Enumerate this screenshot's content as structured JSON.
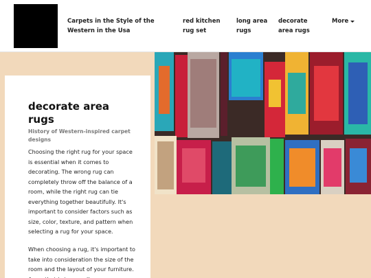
{
  "header": {
    "nav": [
      "Carpets in the Style of the Western in the Usa",
      "red kitchen rug set",
      "long area rugs",
      "decorate area rugs"
    ],
    "more_label": "More"
  },
  "article": {
    "title": "decorate area rugs",
    "subtitle": "History of Western-inspired carpet designs",
    "paragraphs": [
      "Choosing the right rug for your space is essential when it comes to decorating. The wrong rug can completely throw off the balance of a room, while the right rug can tie everything together beautifully. It's important to consider factors such as size, color, texture, and pattern when selecting a rug for your space.",
      "When choosing a rug, it's important to take into consideration the size of the room and the layout of your furniture. A rug that is too small can"
    ]
  },
  "colors": {
    "page_background": "#f2d9bb",
    "header_background": "#ffffff",
    "card_background": "#ffffff"
  },
  "icons": {
    "more": "caret-down-icon"
  }
}
